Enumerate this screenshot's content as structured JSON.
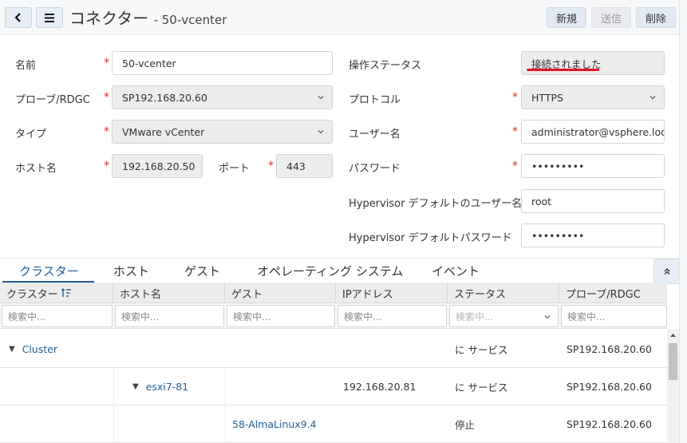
{
  "header": {
    "title": "コネクター",
    "subtitle": "- 50-vcenter",
    "new_label": "新規",
    "send_label": "送信",
    "delete_label": "削除"
  },
  "form": {
    "name": {
      "label": "名前",
      "value": "50-vcenter"
    },
    "probe": {
      "label": "プローブ/RDGC",
      "value": "SP192.168.20.60"
    },
    "type": {
      "label": "タイプ",
      "value": "VMware vCenter"
    },
    "host": {
      "label": "ホスト名",
      "value": "192.168.20.50"
    },
    "port": {
      "label": "ポート",
      "value": "443"
    },
    "op_status": {
      "label": "操作ステータス",
      "value": "接続されました"
    },
    "protocol": {
      "label": "プロトコル",
      "value": "HTTPS"
    },
    "username": {
      "label": "ユーザー名",
      "value": "administrator@vsphere.loca"
    },
    "password": {
      "label": "パスワード",
      "value": "•••••••••"
    },
    "hv_user": {
      "label": "Hypervisor デフォルトのユーザー名",
      "value": "root"
    },
    "hv_password": {
      "label": "Hypervisor デフォルトパスワード",
      "value": "•••••••••"
    },
    "required_mark": "*"
  },
  "tabs": [
    "クラスター",
    "ホスト",
    "ゲスト",
    "オペレーティング システム",
    "イベント"
  ],
  "grid": {
    "headers": [
      "クラスター",
      "ホスト名",
      "ゲスト",
      "IPアドレス",
      "ステータス",
      "プローブ/RDGC"
    ],
    "filter_placeholder": "検索中...",
    "rows": [
      {
        "cluster": "Cluster",
        "host": "",
        "guest": "",
        "ip": "",
        "status": "に サービス",
        "probe": "SP192.168.20.60"
      },
      {
        "cluster": "",
        "host": "esxi7-81",
        "guest": "",
        "ip": "192.168.20.81",
        "status": "に サービス",
        "probe": "SP192.168.20.60"
      },
      {
        "cluster": "",
        "host": "",
        "guest": "58-AlmaLinux9.4",
        "ip": "",
        "status": "停止",
        "probe": "SP192.168.20.60"
      }
    ]
  },
  "icons": {
    "back": "chevron-left-icon",
    "menu": "hamburger-menu-icon",
    "sort": "sort-filter-icon",
    "collapse": "double-chevron-up-icon"
  },
  "colors": {
    "accent": "#1f5f93",
    "required": "#d32f2f",
    "highlight_underline": "#e0141e"
  }
}
